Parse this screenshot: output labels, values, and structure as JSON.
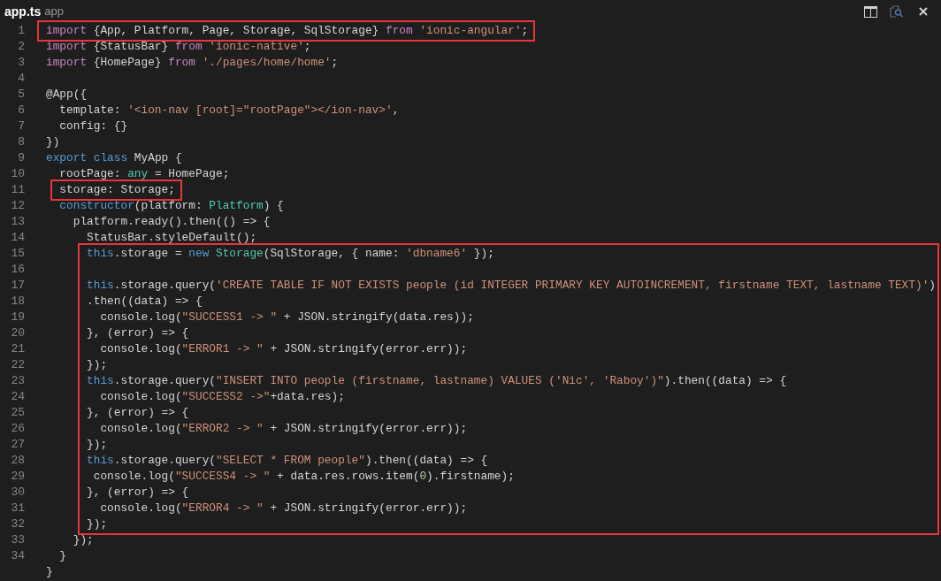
{
  "tab": {
    "title": "app.ts",
    "folder": "app"
  },
  "sections": [
    {
      "framed": true,
      "lines": [
        {
          "number": "1",
          "tokens": [
            {
              "kind": "keyword",
              "text": "import"
            },
            {
              "kind": "plain",
              "text": " {App, Platform, Page, Storage, SqlStorage} "
            },
            {
              "kind": "keyword",
              "text": "from "
            },
            {
              "kind": "string",
              "text": "'ionic-angular'"
            },
            {
              "kind": "plain",
              "text": ";"
            }
          ]
        }
      ]
    },
    {
      "framed": false,
      "lines": [
        {
          "number": "2",
          "tokens": [
            {
              "kind": "keyword",
              "text": "import"
            },
            {
              "kind": "plain",
              "text": " {StatusBar} "
            },
            {
              "kind": "keyword",
              "text": "from "
            },
            {
              "kind": "string",
              "text": "'ionic-native'"
            },
            {
              "kind": "plain",
              "text": ";"
            }
          ]
        },
        {
          "number": "3",
          "tokens": [
            {
              "kind": "keyword",
              "text": "import"
            },
            {
              "kind": "plain",
              "text": " {HomePage} "
            },
            {
              "kind": "keyword",
              "text": "from "
            },
            {
              "kind": "string",
              "text": "'./pages/home/home'"
            },
            {
              "kind": "plain",
              "text": ";"
            }
          ]
        },
        {
          "number": "4"
        },
        {
          "number": "5",
          "tokens": [
            {
              "kind": "plain",
              "text": "@App({"
            }
          ]
        },
        {
          "number": "6",
          "tokens": [
            {
              "kind": "plain",
              "text": "  template: "
            },
            {
              "kind": "string",
              "text": "'<ion-nav [root]=\"rootPage\"></ion-nav>'"
            },
            {
              "kind": "plain",
              "text": ","
            }
          ]
        },
        {
          "number": "7",
          "tokens": [
            {
              "kind": "plain",
              "text": "  config: {}"
            }
          ]
        },
        {
          "number": "8",
          "tokens": [
            {
              "kind": "plain",
              "text": "})"
            }
          ]
        },
        {
          "number": "9",
          "tokens": [
            {
              "kind": "storage",
              "text": "export "
            },
            {
              "kind": "storage",
              "text": "class"
            },
            {
              "kind": "plain",
              "text": " MyApp {"
            }
          ]
        },
        {
          "number": "10",
          "tokens": [
            {
              "kind": "plain",
              "text": "  rootPage: "
            },
            {
              "kind": "type",
              "text": "any"
            },
            {
              "kind": "plain",
              "text": " = HomePage;"
            }
          ]
        }
      ]
    },
    {
      "framed": true,
      "lines": [
        {
          "number": "11",
          "tokens": [
            {
              "kind": "plain",
              "text": "  storage: Storage;"
            }
          ]
        }
      ]
    },
    {
      "framed": false,
      "lines": [
        {
          "number": "12",
          "tokens": [
            {
              "kind": "storage",
              "text": "  constructor"
            },
            {
              "kind": "plain",
              "text": "(platform: "
            },
            {
              "kind": "type",
              "text": "Platform"
            },
            {
              "kind": "plain",
              "text": ") {"
            }
          ]
        },
        {
          "number": "13",
          "tokens": [
            {
              "kind": "plain",
              "text": "    platform.ready().then(() => {"
            }
          ]
        },
        {
          "number": "14",
          "tokens": [
            {
              "kind": "plain",
              "text": "      StatusBar.styleDefault();"
            }
          ]
        }
      ]
    },
    {
      "framed": true,
      "lines": [
        {
          "number": "15",
          "tokens": [
            {
              "kind": "storage",
              "text": "      this"
            },
            {
              "kind": "plain",
              "text": ".storage = "
            },
            {
              "kind": "storage",
              "text": "new "
            },
            {
              "kind": "type",
              "text": "Storage"
            },
            {
              "kind": "plain",
              "text": "(SqlStorage, { name: "
            },
            {
              "kind": "string",
              "text": "'dbname6'"
            },
            {
              "kind": "plain",
              "text": " });"
            }
          ]
        },
        {
          "number": "16"
        },
        {
          "number": "17",
          "tokens": [
            {
              "kind": "storage",
              "text": "      this"
            },
            {
              "kind": "plain",
              "text": ".storage.query("
            },
            {
              "kind": "string",
              "text": "'CREATE TABLE IF NOT EXISTS people (id INTEGER PRIMARY KEY AUTOINCREMENT, firstname TEXT, lastname TEXT)'"
            },
            {
              "kind": "plain",
              "text": ")"
            }
          ]
        },
        {
          "number": "18",
          "tokens": [
            {
              "kind": "plain",
              "text": "      .then((data) => {"
            }
          ]
        },
        {
          "number": "19",
          "tokens": [
            {
              "kind": "plain",
              "text": "        console.log("
            },
            {
              "kind": "string",
              "text": "\"SUCCESS1 -> \""
            },
            {
              "kind": "plain",
              "text": " + JSON.stringify(data.res));"
            }
          ]
        },
        {
          "number": "20",
          "tokens": [
            {
              "kind": "plain",
              "text": "      }, (error) => {"
            }
          ]
        },
        {
          "number": "21",
          "tokens": [
            {
              "kind": "plain",
              "text": "        console.log("
            },
            {
              "kind": "string",
              "text": "\"ERROR1 -> \""
            },
            {
              "kind": "plain",
              "text": " + JSON.stringify(error.err));"
            }
          ]
        },
        {
          "number": "22",
          "tokens": [
            {
              "kind": "plain",
              "text": "      });"
            }
          ]
        },
        {
          "number": "23",
          "tokens": [
            {
              "kind": "storage",
              "text": "      this"
            },
            {
              "kind": "plain",
              "text": ".storage.query("
            },
            {
              "kind": "string",
              "text": "\"INSERT INTO people (firstname, lastname) VALUES ('Nic', 'Raboy')\""
            },
            {
              "kind": "plain",
              "text": ").then((data) => {"
            }
          ]
        },
        {
          "number": "24",
          "tokens": [
            {
              "kind": "plain",
              "text": "        console.log("
            },
            {
              "kind": "string",
              "text": "\"SUCCESS2 ->\""
            },
            {
              "kind": "plain",
              "text": "+data.res);"
            }
          ]
        },
        {
          "number": "25",
          "tokens": [
            {
              "kind": "plain",
              "text": "      }, (error) => {"
            }
          ]
        },
        {
          "number": "26",
          "tokens": [
            {
              "kind": "plain",
              "text": "        console.log("
            },
            {
              "kind": "string",
              "text": "\"ERROR2 -> \""
            },
            {
              "kind": "plain",
              "text": " + JSON.stringify(error.err));"
            }
          ]
        },
        {
          "number": "27",
          "tokens": [
            {
              "kind": "plain",
              "text": "      });"
            }
          ]
        },
        {
          "number": "28",
          "tokens": [
            {
              "kind": "storage",
              "text": "      this"
            },
            {
              "kind": "plain",
              "text": ".storage.query("
            },
            {
              "kind": "string",
              "text": "\"SELECT * FROM people\""
            },
            {
              "kind": "plain",
              "text": ").then((data) => {"
            }
          ]
        },
        {
          "number": "29",
          "tokens": [
            {
              "kind": "plain",
              "text": "       console.log("
            },
            {
              "kind": "string",
              "text": "\"SUCCESS4 -> \""
            },
            {
              "kind": "plain",
              "text": " + data.res.rows.item("
            },
            {
              "kind": "number",
              "text": "0"
            },
            {
              "kind": "plain",
              "text": ").firstname);"
            }
          ]
        },
        {
          "number": "30",
          "tokens": [
            {
              "kind": "plain",
              "text": "      }, (error) => {"
            }
          ]
        },
        {
          "number": "31",
          "tokens": [
            {
              "kind": "plain",
              "text": "        console.log("
            },
            {
              "kind": "string",
              "text": "\"ERROR4 -> \""
            },
            {
              "kind": "plain",
              "text": " + JSON.stringify(error.err));"
            }
          ]
        },
        {
          "number": "32",
          "tokens": [
            {
              "kind": "plain",
              "text": "      });"
            }
          ]
        }
      ]
    },
    {
      "framed": false,
      "lines": [
        {
          "number": "33",
          "tokens": [
            {
              "kind": "plain",
              "text": "    });"
            }
          ]
        },
        {
          "number": "34",
          "tokens": [
            {
              "kind": "plain",
              "text": "  }"
            }
          ]
        },
        {
          "tokens": [
            {
              "kind": "plain",
              "text": "}"
            }
          ]
        }
      ]
    }
  ]
}
